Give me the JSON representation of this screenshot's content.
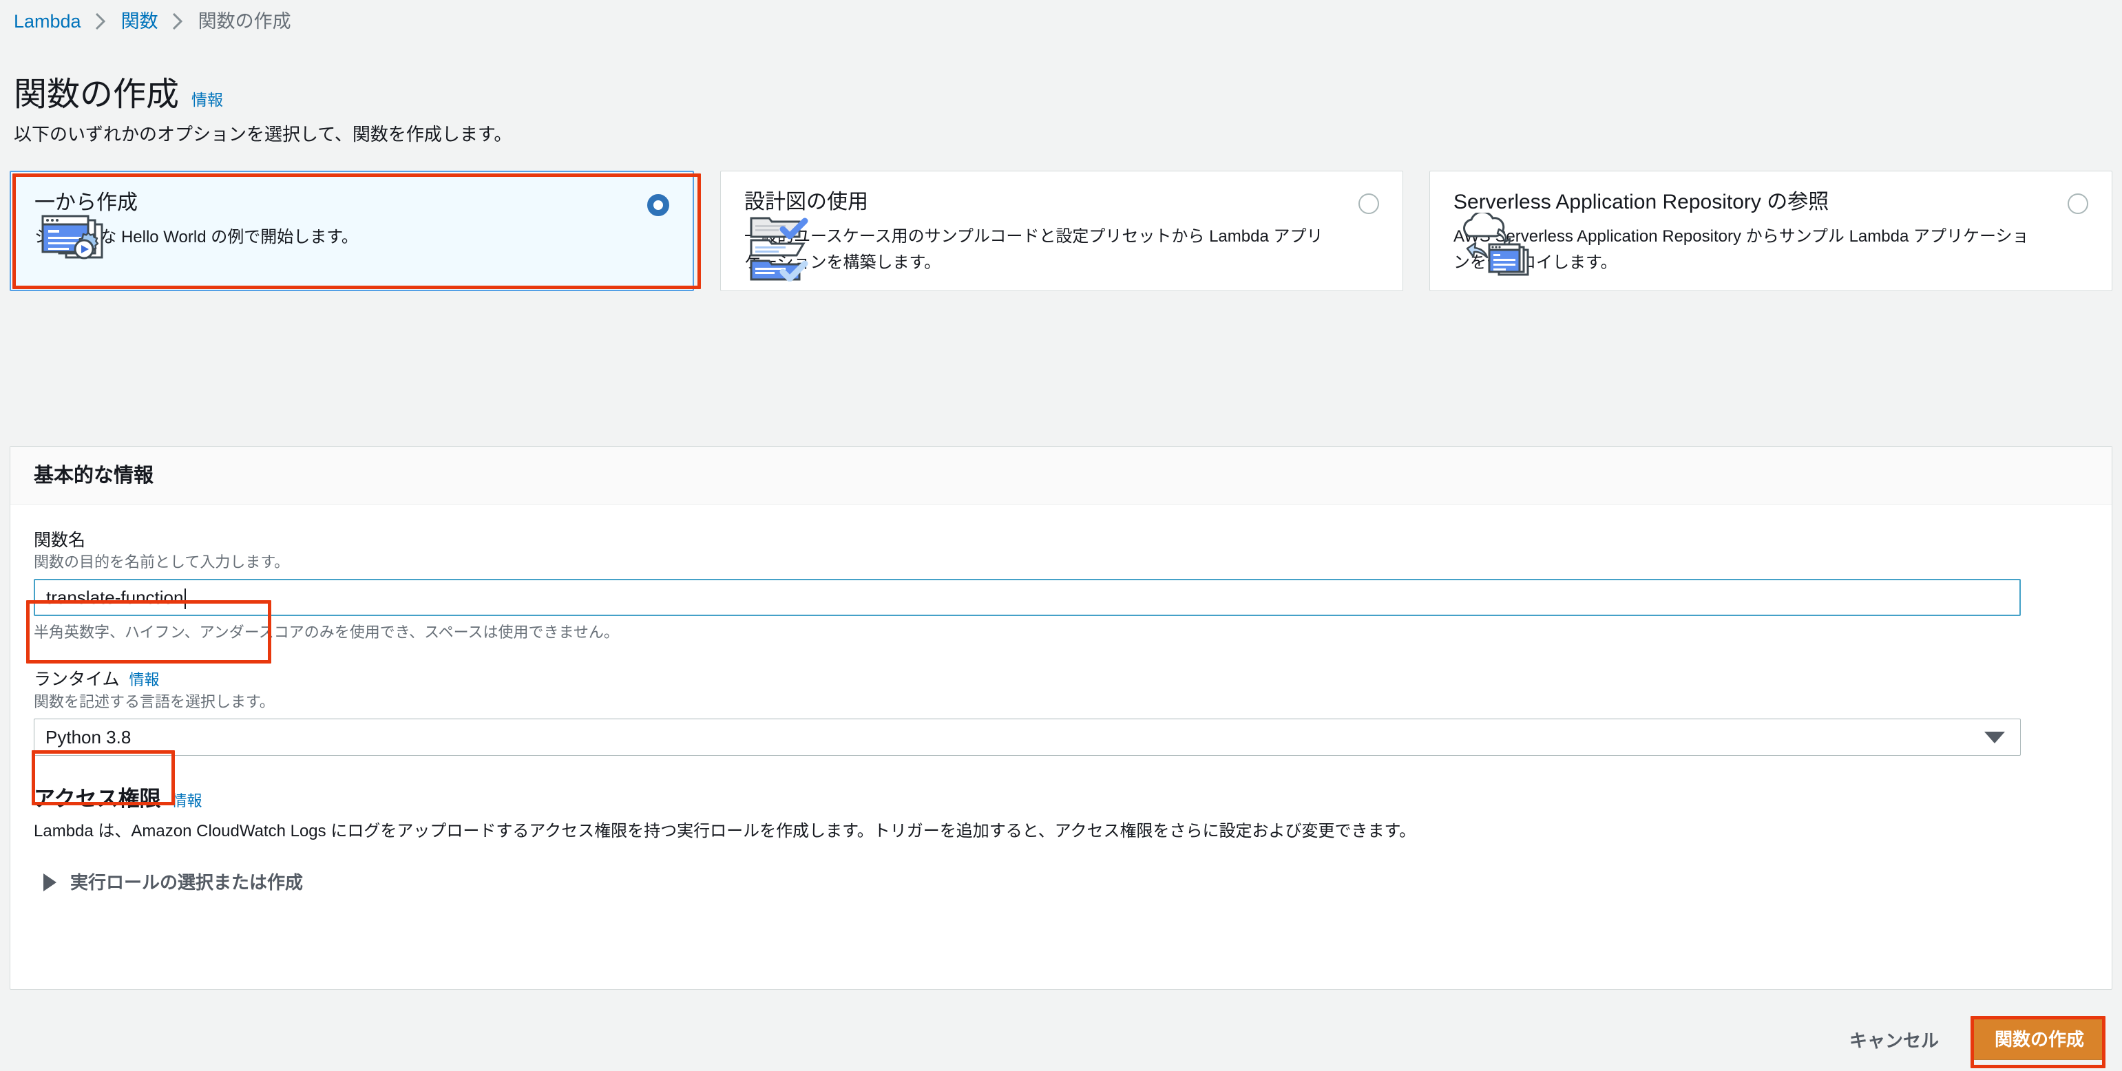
{
  "breadcrumb": {
    "items": [
      {
        "label": "Lambda",
        "type": "link"
      },
      {
        "label": "関数",
        "type": "link"
      },
      {
        "label": "関数の作成",
        "type": "current"
      }
    ]
  },
  "header": {
    "title": "関数の作成",
    "info_label": "情報",
    "description": "以下のいずれかのオプションを選択して、関数を作成します。"
  },
  "options": {
    "cards": [
      {
        "title": "一から作成",
        "description": "シンプルな Hello World の例で開始します。",
        "selected": true,
        "icon": "browser-window-gear-play-icon"
      },
      {
        "title": "設計図の使用",
        "description": "一般的ユースケース用のサンプルコードと設定プリセットから Lambda アプリケーションを構築します。",
        "selected": false,
        "icon": "blueprint-checklist-icon"
      },
      {
        "title": "Serverless Application Repository の参照",
        "description": "AWS Serverless Application Repository からサンプル Lambda アプリケーションをデプロイします。",
        "selected": false,
        "icon": "cloud-deploy-windows-icon"
      }
    ]
  },
  "basic_info": {
    "panel_title": "基本的な情報",
    "function_name": {
      "label": "関数名",
      "hint": "関数の目的を名前として入力します。",
      "value": "translate-function",
      "placeholder": "",
      "helper": "半角英数字、ハイフン、アンダースコアのみを使用でき、スペースは使用できません。"
    },
    "runtime": {
      "label": "ランタイム",
      "info_label": "情報",
      "hint": "関数を記述する言語を選択します。",
      "value": "Python 3.8"
    }
  },
  "permissions": {
    "title": "アクセス権限",
    "info_label": "情報",
    "description": "Lambda は、Amazon CloudWatch Logs にログをアップロードするアクセス権限を持つ実行ロールを作成します。トリガーを追加すると、アクセス権限をさらに設定および変更できます。",
    "expander_label": "実行ロールの選択または作成"
  },
  "footer": {
    "cancel_label": "キャンセル",
    "create_label": "関数の作成"
  },
  "colors": {
    "accent_link": "#0073bb",
    "selected_card_border": "#539fe5",
    "selected_card_bg": "#f1faff",
    "radio_selected": "#2e72b8",
    "input_focus_border": "#44a1c8",
    "primary_button": "#d9832a",
    "annotation": "#e8380d",
    "page_bg": "#f2f3f3"
  }
}
